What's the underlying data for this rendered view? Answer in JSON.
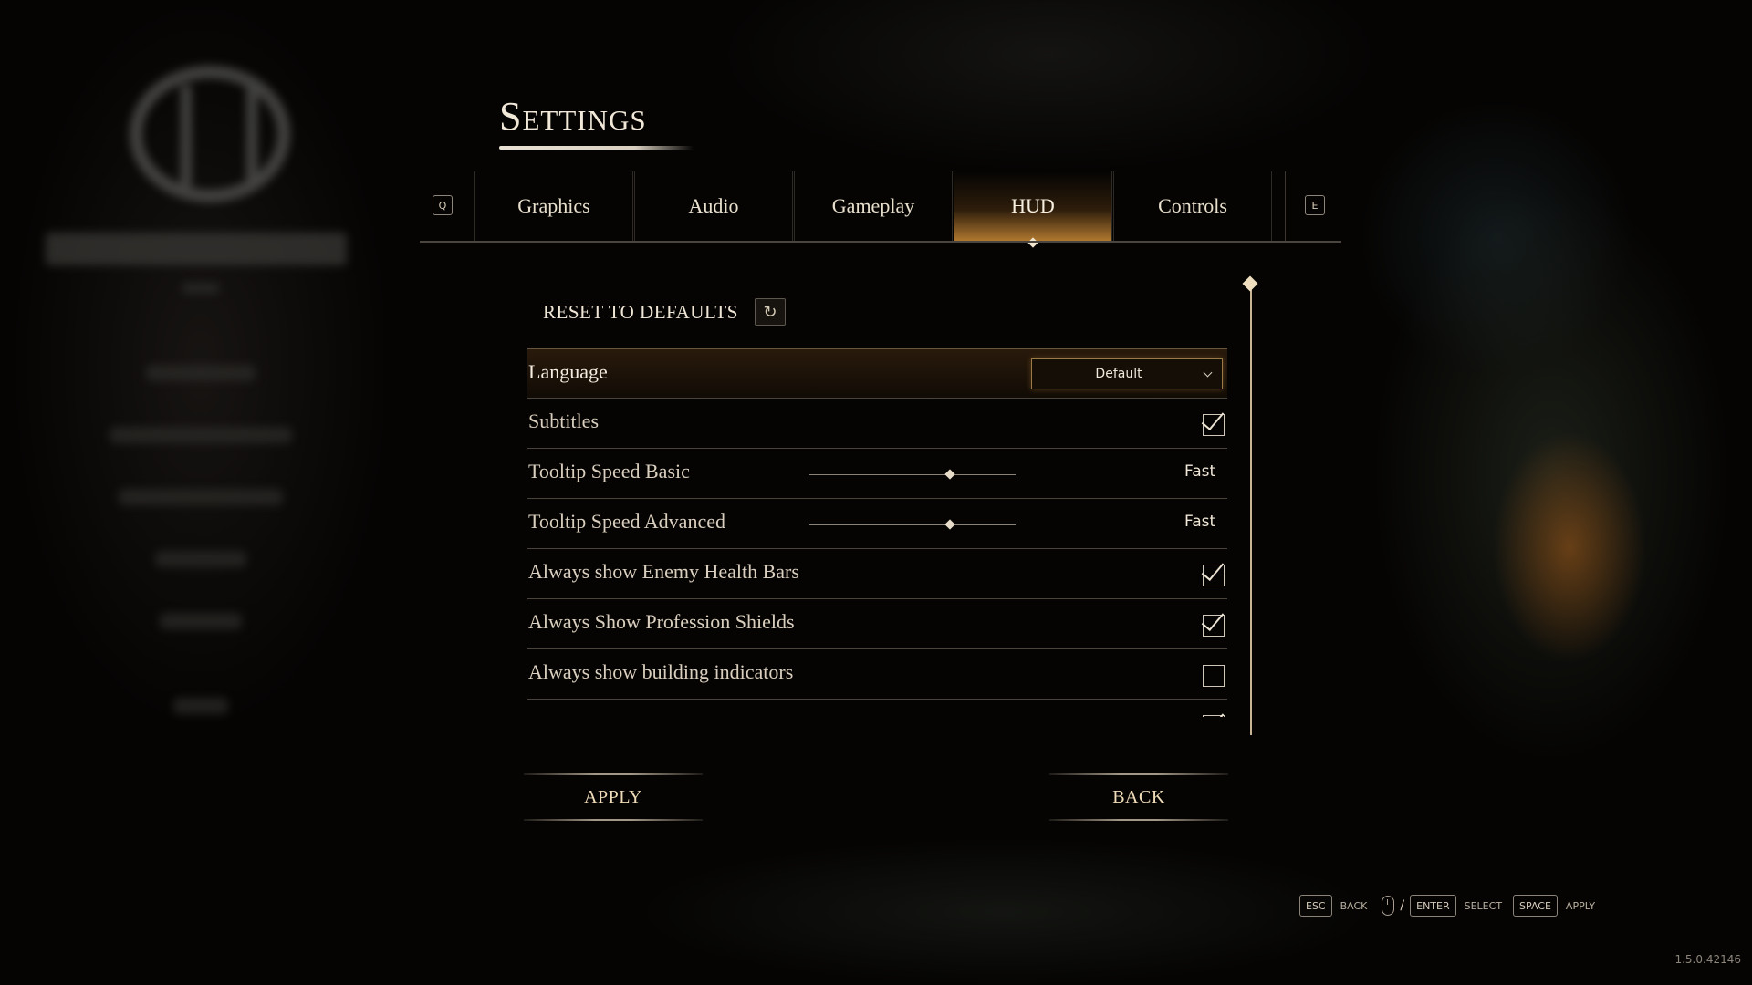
{
  "page": {
    "title": "Settings",
    "version": "1.5.0.42146"
  },
  "tabs": {
    "prev_key": "Q",
    "next_key": "E",
    "items": [
      {
        "label": "Graphics"
      },
      {
        "label": "Audio"
      },
      {
        "label": "Gameplay"
      },
      {
        "label": "HUD",
        "active": true
      },
      {
        "label": "Controls"
      }
    ]
  },
  "reset": {
    "label": "RESET TO DEFAULTS",
    "icon": "refresh-icon"
  },
  "settings": {
    "language": {
      "label": "Language",
      "value": "Default"
    },
    "subtitles": {
      "label": "Subtitles",
      "checked": true
    },
    "tooltip_basic": {
      "label": "Tooltip Speed Basic",
      "value": "Fast"
    },
    "tooltip_advanced": {
      "label": "Tooltip Speed Advanced",
      "value": "Fast"
    },
    "enemy_health": {
      "label": "Always show Enemy Health Bars",
      "checked": true
    },
    "profession_shields": {
      "label": "Always Show Profession Shields",
      "checked": true
    },
    "building_indicators": {
      "label": "Always show building indicators",
      "checked": false
    }
  },
  "actions": {
    "apply": "APPLY",
    "back": "BACK"
  },
  "hints": {
    "esc_key": "ESC",
    "esc_label": "BACK",
    "slash": "/",
    "enter_key": "ENTER",
    "enter_label": "SELECT",
    "space_key": "SPACE",
    "space_label": "APPLY"
  },
  "colors": {
    "accent": "#c98a3c",
    "text": "#d9cdb8"
  }
}
